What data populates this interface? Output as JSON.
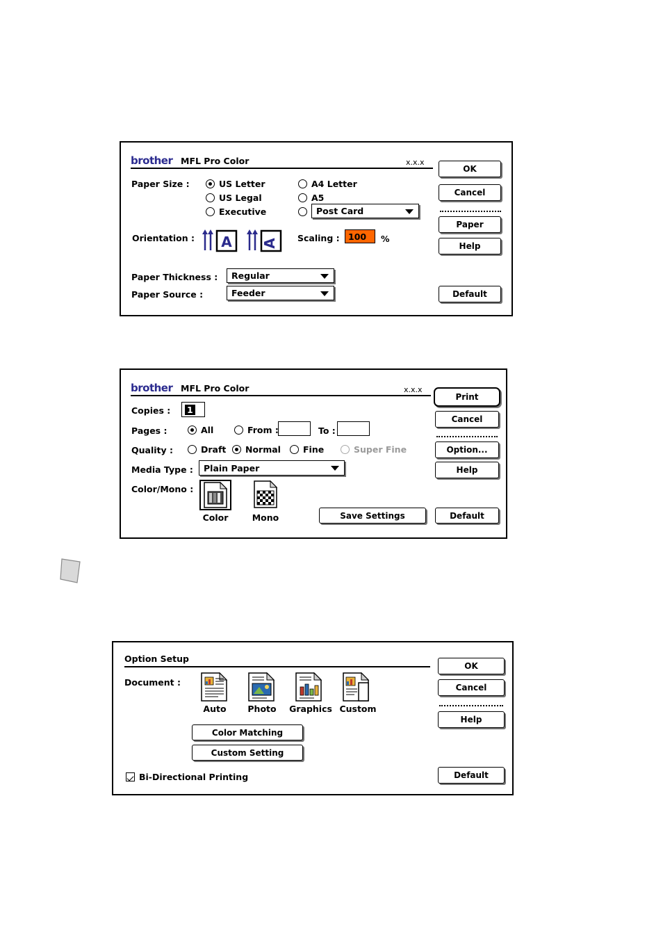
{
  "page_setup": {
    "brand": "brother",
    "title": "MFL Pro Color",
    "version": "x.x.x",
    "paper_size_label": "Paper Size :",
    "paper_sizes": [
      {
        "label": "US Letter",
        "selected": true
      },
      {
        "label": "US Legal",
        "selected": false
      },
      {
        "label": "Executive",
        "selected": false
      },
      {
        "label": "A4 Letter",
        "selected": false
      },
      {
        "label": "A5",
        "selected": false
      },
      {
        "label": "",
        "selected": false
      }
    ],
    "postcard_popup": "Post Card",
    "orientation_label": "Orientation :",
    "orientation_portrait_selected": true,
    "scaling_label": "Scaling :",
    "scaling_value": "100",
    "scaling_percent": "%",
    "paper_thickness_label": "Paper Thickness :",
    "paper_thickness_value": "Regular",
    "paper_source_label": "Paper Source :",
    "paper_source_value": "Feeder",
    "buttons": {
      "ok": "OK",
      "cancel": "Cancel",
      "paper": "Paper",
      "help": "Help",
      "default": "Default"
    }
  },
  "print_dialog": {
    "brand": "brother",
    "title": "MFL Pro Color",
    "version": "x.x.x",
    "copies_label": "Copies :",
    "copies_value": "1",
    "pages_label": "Pages :",
    "pages_all": "All",
    "pages_from": "From :",
    "pages_from_value": "",
    "pages_to": "To :",
    "pages_to_value": "",
    "quality_label": "Quality :",
    "quality_options": [
      {
        "label": "Draft",
        "selected": false,
        "disabled": false
      },
      {
        "label": "Normal",
        "selected": true,
        "disabled": false
      },
      {
        "label": "Fine",
        "selected": false,
        "disabled": false
      },
      {
        "label": "Super Fine",
        "selected": false,
        "disabled": true
      }
    ],
    "media_type_label": "Media Type :",
    "media_type_value": "Plain Paper",
    "color_mono_label": "Color/Mono :",
    "color_caption": "Color",
    "mono_caption": "Mono",
    "buttons": {
      "print": "Print",
      "cancel": "Cancel",
      "option": "Option...",
      "help": "Help",
      "save_settings": "Save Settings",
      "default": "Default"
    }
  },
  "option_setup": {
    "title": "Option Setup",
    "document_label": "Document :",
    "document_icons": [
      {
        "caption": "Auto"
      },
      {
        "caption": "Photo"
      },
      {
        "caption": "Graphics"
      },
      {
        "caption": "Custom"
      }
    ],
    "color_matching": "Color Matching",
    "custom_setting": "Custom Setting",
    "bidirectional_label": "Bi-Directional Printing",
    "bidirectional_checked": true,
    "buttons": {
      "ok": "OK",
      "cancel": "Cancel",
      "help": "Help",
      "default": "Default"
    }
  }
}
